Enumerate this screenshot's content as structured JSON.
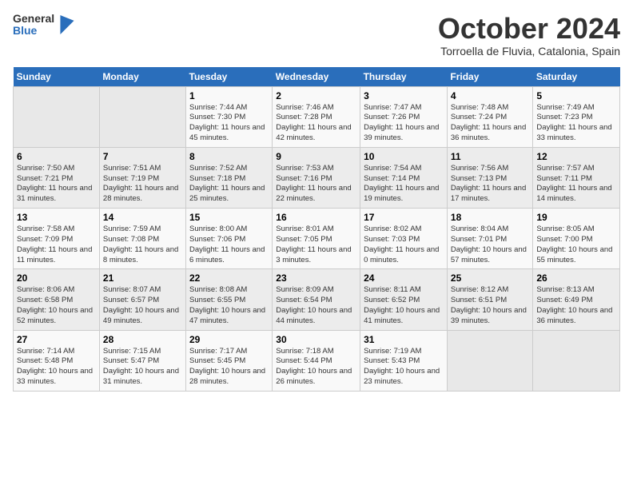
{
  "logo": {
    "general": "General",
    "blue": "Blue"
  },
  "header": {
    "month": "October 2024",
    "location": "Torroella de Fluvia, Catalonia, Spain"
  },
  "days_of_week": [
    "Sunday",
    "Monday",
    "Tuesday",
    "Wednesday",
    "Thursday",
    "Friday",
    "Saturday"
  ],
  "weeks": [
    [
      {
        "day": "",
        "content": ""
      },
      {
        "day": "",
        "content": ""
      },
      {
        "day": "1",
        "content": "Sunrise: 7:44 AM\nSunset: 7:30 PM\nDaylight: 11 hours and 45 minutes."
      },
      {
        "day": "2",
        "content": "Sunrise: 7:46 AM\nSunset: 7:28 PM\nDaylight: 11 hours and 42 minutes."
      },
      {
        "day": "3",
        "content": "Sunrise: 7:47 AM\nSunset: 7:26 PM\nDaylight: 11 hours and 39 minutes."
      },
      {
        "day": "4",
        "content": "Sunrise: 7:48 AM\nSunset: 7:24 PM\nDaylight: 11 hours and 36 minutes."
      },
      {
        "day": "5",
        "content": "Sunrise: 7:49 AM\nSunset: 7:23 PM\nDaylight: 11 hours and 33 minutes."
      }
    ],
    [
      {
        "day": "6",
        "content": "Sunrise: 7:50 AM\nSunset: 7:21 PM\nDaylight: 11 hours and 31 minutes."
      },
      {
        "day": "7",
        "content": "Sunrise: 7:51 AM\nSunset: 7:19 PM\nDaylight: 11 hours and 28 minutes."
      },
      {
        "day": "8",
        "content": "Sunrise: 7:52 AM\nSunset: 7:18 PM\nDaylight: 11 hours and 25 minutes."
      },
      {
        "day": "9",
        "content": "Sunrise: 7:53 AM\nSunset: 7:16 PM\nDaylight: 11 hours and 22 minutes."
      },
      {
        "day": "10",
        "content": "Sunrise: 7:54 AM\nSunset: 7:14 PM\nDaylight: 11 hours and 19 minutes."
      },
      {
        "day": "11",
        "content": "Sunrise: 7:56 AM\nSunset: 7:13 PM\nDaylight: 11 hours and 17 minutes."
      },
      {
        "day": "12",
        "content": "Sunrise: 7:57 AM\nSunset: 7:11 PM\nDaylight: 11 hours and 14 minutes."
      }
    ],
    [
      {
        "day": "13",
        "content": "Sunrise: 7:58 AM\nSunset: 7:09 PM\nDaylight: 11 hours and 11 minutes."
      },
      {
        "day": "14",
        "content": "Sunrise: 7:59 AM\nSunset: 7:08 PM\nDaylight: 11 hours and 8 minutes."
      },
      {
        "day": "15",
        "content": "Sunrise: 8:00 AM\nSunset: 7:06 PM\nDaylight: 11 hours and 6 minutes."
      },
      {
        "day": "16",
        "content": "Sunrise: 8:01 AM\nSunset: 7:05 PM\nDaylight: 11 hours and 3 minutes."
      },
      {
        "day": "17",
        "content": "Sunrise: 8:02 AM\nSunset: 7:03 PM\nDaylight: 11 hours and 0 minutes."
      },
      {
        "day": "18",
        "content": "Sunrise: 8:04 AM\nSunset: 7:01 PM\nDaylight: 10 hours and 57 minutes."
      },
      {
        "day": "19",
        "content": "Sunrise: 8:05 AM\nSunset: 7:00 PM\nDaylight: 10 hours and 55 minutes."
      }
    ],
    [
      {
        "day": "20",
        "content": "Sunrise: 8:06 AM\nSunset: 6:58 PM\nDaylight: 10 hours and 52 minutes."
      },
      {
        "day": "21",
        "content": "Sunrise: 8:07 AM\nSunset: 6:57 PM\nDaylight: 10 hours and 49 minutes."
      },
      {
        "day": "22",
        "content": "Sunrise: 8:08 AM\nSunset: 6:55 PM\nDaylight: 10 hours and 47 minutes."
      },
      {
        "day": "23",
        "content": "Sunrise: 8:09 AM\nSunset: 6:54 PM\nDaylight: 10 hours and 44 minutes."
      },
      {
        "day": "24",
        "content": "Sunrise: 8:11 AM\nSunset: 6:52 PM\nDaylight: 10 hours and 41 minutes."
      },
      {
        "day": "25",
        "content": "Sunrise: 8:12 AM\nSunset: 6:51 PM\nDaylight: 10 hours and 39 minutes."
      },
      {
        "day": "26",
        "content": "Sunrise: 8:13 AM\nSunset: 6:49 PM\nDaylight: 10 hours and 36 minutes."
      }
    ],
    [
      {
        "day": "27",
        "content": "Sunrise: 7:14 AM\nSunset: 5:48 PM\nDaylight: 10 hours and 33 minutes."
      },
      {
        "day": "28",
        "content": "Sunrise: 7:15 AM\nSunset: 5:47 PM\nDaylight: 10 hours and 31 minutes."
      },
      {
        "day": "29",
        "content": "Sunrise: 7:17 AM\nSunset: 5:45 PM\nDaylight: 10 hours and 28 minutes."
      },
      {
        "day": "30",
        "content": "Sunrise: 7:18 AM\nSunset: 5:44 PM\nDaylight: 10 hours and 26 minutes."
      },
      {
        "day": "31",
        "content": "Sunrise: 7:19 AM\nSunset: 5:43 PM\nDaylight: 10 hours and 23 minutes."
      },
      {
        "day": "",
        "content": ""
      },
      {
        "day": "",
        "content": ""
      }
    ]
  ]
}
